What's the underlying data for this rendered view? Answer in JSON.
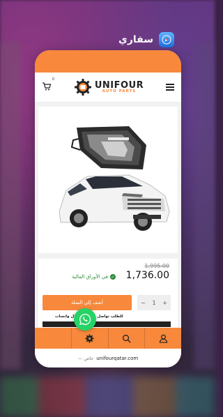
{
  "app_switcher": {
    "app_name": "سفاري",
    "app_icon": "safari-icon"
  },
  "site": {
    "logo_title": "UNIFOUR",
    "logo_subtitle": "AUTO PARTS",
    "cart_count": "0",
    "brand_color": "#f7883c"
  },
  "product": {
    "old_price": "1,995.00",
    "price": "1,736.00",
    "stock_label": "في الأوراق المالية",
    "add_to_cart_label": "أضف إلى السلة",
    "quantity": "1",
    "qty_minus": "−",
    "qty_plus": "+",
    "whatsapp_note": "للطلب تواصل معنا من خلال واتساب"
  },
  "bottom_nav": [
    {
      "icon": "user-icon"
    },
    {
      "icon": "search-icon"
    },
    {
      "icon": "gear-icon"
    },
    {
      "icon": "blank"
    }
  ],
  "browser": {
    "url": "unifourqatar.com",
    "private_label": "— خاص"
  }
}
